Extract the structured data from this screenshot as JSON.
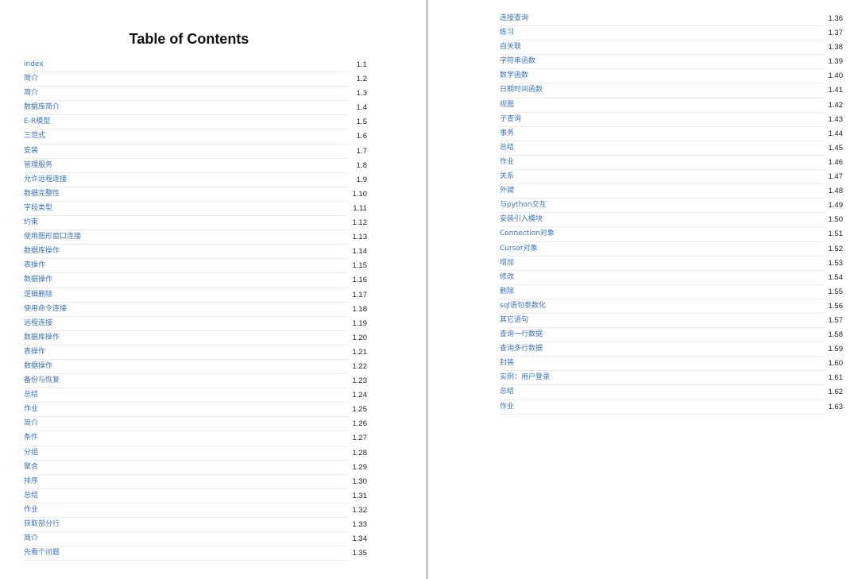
{
  "document": {
    "title": "Table of Contents"
  },
  "toc_left": [
    {
      "label": "index",
      "number": "1.1"
    },
    {
      "label": "简介",
      "number": "1.2"
    },
    {
      "label": "简介",
      "number": "1.3"
    },
    {
      "label": "数据库简介",
      "number": "1.4"
    },
    {
      "label": "E-R模型",
      "number": "1.5"
    },
    {
      "label": "三范式",
      "number": "1.6"
    },
    {
      "label": "安装",
      "number": "1.7"
    },
    {
      "label": "管理服务",
      "number": "1.8"
    },
    {
      "label": "允许远程连接",
      "number": "1.9"
    },
    {
      "label": "数据完整性",
      "number": "1.10"
    },
    {
      "label": "字段类型",
      "number": "1.11"
    },
    {
      "label": "约束",
      "number": "1.12"
    },
    {
      "label": "使用图形窗口连接",
      "number": "1.13"
    },
    {
      "label": "数据库操作",
      "number": "1.14"
    },
    {
      "label": "表操作",
      "number": "1.15"
    },
    {
      "label": "数据操作",
      "number": "1.16"
    },
    {
      "label": "逻辑删除",
      "number": "1.17"
    },
    {
      "label": "使用命令连接",
      "number": "1.18"
    },
    {
      "label": "远程连接",
      "number": "1.19"
    },
    {
      "label": "数据库操作",
      "number": "1.20"
    },
    {
      "label": "表操作",
      "number": "1.21"
    },
    {
      "label": "数据操作",
      "number": "1.22"
    },
    {
      "label": "备份与恢复",
      "number": "1.23"
    },
    {
      "label": "总结",
      "number": "1.24"
    },
    {
      "label": "作业",
      "number": "1.25"
    },
    {
      "label": "简介",
      "number": "1.26"
    },
    {
      "label": "条件",
      "number": "1.27"
    },
    {
      "label": "分组",
      "number": "1.28"
    },
    {
      "label": "聚合",
      "number": "1.29"
    },
    {
      "label": "排序",
      "number": "1.30"
    },
    {
      "label": "总结",
      "number": "1.31"
    },
    {
      "label": "作业",
      "number": "1.32"
    },
    {
      "label": "获取部分行",
      "number": "1.33"
    },
    {
      "label": "简介",
      "number": "1.34"
    },
    {
      "label": "先看个问题",
      "number": "1.35"
    }
  ],
  "toc_right": [
    {
      "label": "连接查询",
      "number": "1.36"
    },
    {
      "label": "练习",
      "number": "1.37"
    },
    {
      "label": "自关联",
      "number": "1.38"
    },
    {
      "label": "字符串函数",
      "number": "1.39"
    },
    {
      "label": "数学函数",
      "number": "1.40"
    },
    {
      "label": "日期时间函数",
      "number": "1.41"
    },
    {
      "label": "视图",
      "number": "1.42"
    },
    {
      "label": "子查询",
      "number": "1.43"
    },
    {
      "label": "事务",
      "number": "1.44"
    },
    {
      "label": "总结",
      "number": "1.45"
    },
    {
      "label": "作业",
      "number": "1.46"
    },
    {
      "label": "关系",
      "number": "1.47"
    },
    {
      "label": "外键",
      "number": "1.48"
    },
    {
      "label": "与python交互",
      "number": "1.49"
    },
    {
      "label": "安装引入模块",
      "number": "1.50"
    },
    {
      "label": "Connection对象",
      "number": "1.51"
    },
    {
      "label": "Cursor对象",
      "number": "1.52"
    },
    {
      "label": "增加",
      "number": "1.53"
    },
    {
      "label": "修改",
      "number": "1.54"
    },
    {
      "label": "删除",
      "number": "1.55"
    },
    {
      "label": "sql语句参数化",
      "number": "1.56"
    },
    {
      "label": "其它语句",
      "number": "1.57"
    },
    {
      "label": "查询一行数据",
      "number": "1.58"
    },
    {
      "label": "查询多行数据",
      "number": "1.59"
    },
    {
      "label": "封装",
      "number": "1.60"
    },
    {
      "label": "实例：用户登录",
      "number": "1.61"
    },
    {
      "label": "总结",
      "number": "1.62"
    },
    {
      "label": "作业",
      "number": "1.63"
    }
  ],
  "colors": {
    "link": "#3b73b9",
    "number": "#222222",
    "divider": "#ececec",
    "gutter": "#c9c9c9"
  }
}
